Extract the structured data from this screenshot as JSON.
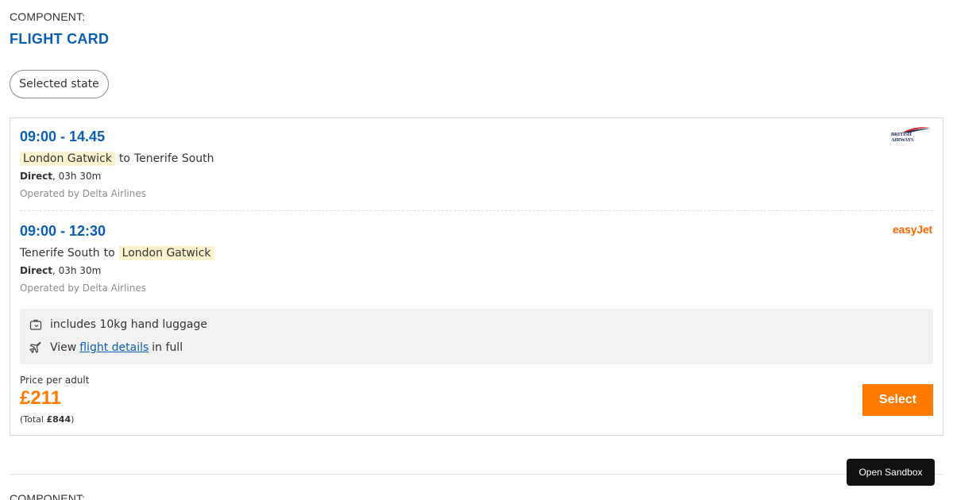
{
  "header": {
    "component_label": "COMPONENT:",
    "component_title": "FLIGHT CARD",
    "state_pill": "Selected state"
  },
  "card": {
    "legs": [
      {
        "time": "09:00 - 14.45",
        "origin": "London Gatwick",
        "connector": "to",
        "destination": "Tenerife South",
        "highlighted": "origin",
        "stops": "Direct",
        "duration": ", 03h 30m",
        "operated_by": "Operated by Delta Airlines",
        "airline_logo": "British Airways",
        "airline_logo_lines": [
          "BRITISH",
          "AIRWAYS"
        ]
      },
      {
        "time": "09:00 - 12:30",
        "origin": "Tenerife South",
        "connector": "to",
        "destination": "London Gatwick",
        "highlighted": "destination",
        "stops": "Direct",
        "duration": ", 03h 30m",
        "operated_by": "Operated by Delta Airlines",
        "airline_logo": "easyJet"
      }
    ],
    "info": {
      "luggage_text": "includes 10kg hand luggage",
      "details_prefix": "View",
      "details_link": "flight details",
      "details_suffix": "in full",
      "luggage_icon": "luggage-icon",
      "details_icon": "plane-icon"
    },
    "price": {
      "label": "Price per adult",
      "amount": "£211",
      "total_prefix": "(Total ",
      "total_amount": "£844",
      "total_suffix": ")"
    },
    "select_label": "Select"
  },
  "footer": {
    "component_label": "COMPONENT:",
    "sandbox_label": "Open Sandbox"
  },
  "colors": {
    "brand_blue": "#0a5fb4",
    "accent_orange": "#ff7a00",
    "highlight": "#fdf3cf",
    "easyjet_orange": "#ff6600",
    "info_bg": "#f2f2f2"
  }
}
